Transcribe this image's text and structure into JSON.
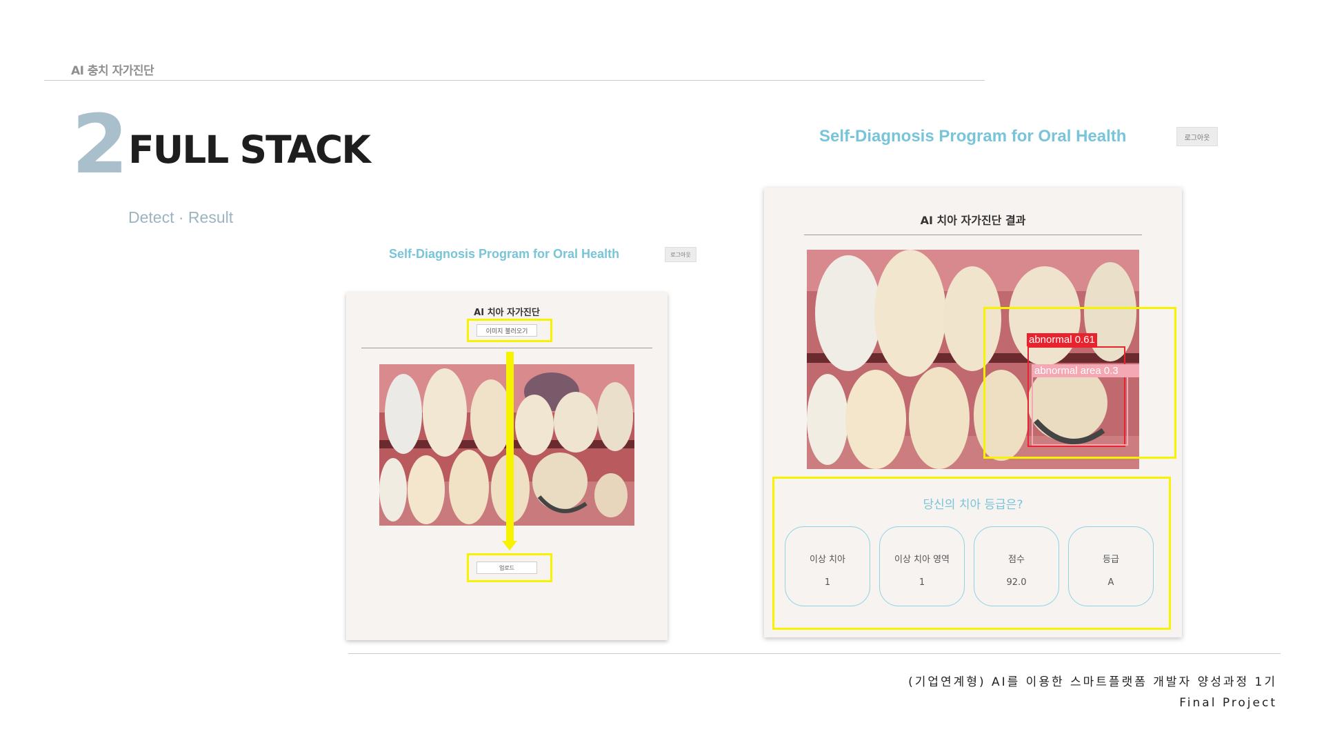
{
  "header": {
    "title": "AI 충치 자가진단"
  },
  "section": {
    "number": "2",
    "title": "FULL STACK",
    "subtitle": "Detect · Result"
  },
  "left_screen": {
    "app_title": "Self-Diagnosis Program for Oral Health",
    "logout_label": "로그아웃",
    "card_title": "AI 치아 자가진단",
    "load_image_button": "이미지 불러오기",
    "upload_button": "업로드"
  },
  "right_screen": {
    "app_title": "Self-Diagnosis Program for Oral Health",
    "logout_label": "로그아웃",
    "card_title": "AI 치아 자가진단 결과",
    "detections": [
      {
        "label": "abnormal 0.61"
      },
      {
        "label": "abnormal area 0.3"
      }
    ],
    "grade_question": "당신의 치아 등급은?",
    "stats": [
      {
        "label": "이상 치아",
        "value": "1"
      },
      {
        "label": "이상 치아 영역",
        "value": "1"
      },
      {
        "label": "점수",
        "value": "92.0"
      },
      {
        "label": "등급",
        "value": "A"
      }
    ]
  },
  "footer": {
    "line1": "(기업연계형) AI를 이용한 스마트플랫폼 개발자 양성과정 1기",
    "line2": "Final Project"
  },
  "colors": {
    "accent": "#78c4d8",
    "highlight": "#f7f200",
    "detect_abnormal": "#e8232e",
    "detect_area": "#f3a8b4",
    "section_number": "#a9c0cc"
  }
}
